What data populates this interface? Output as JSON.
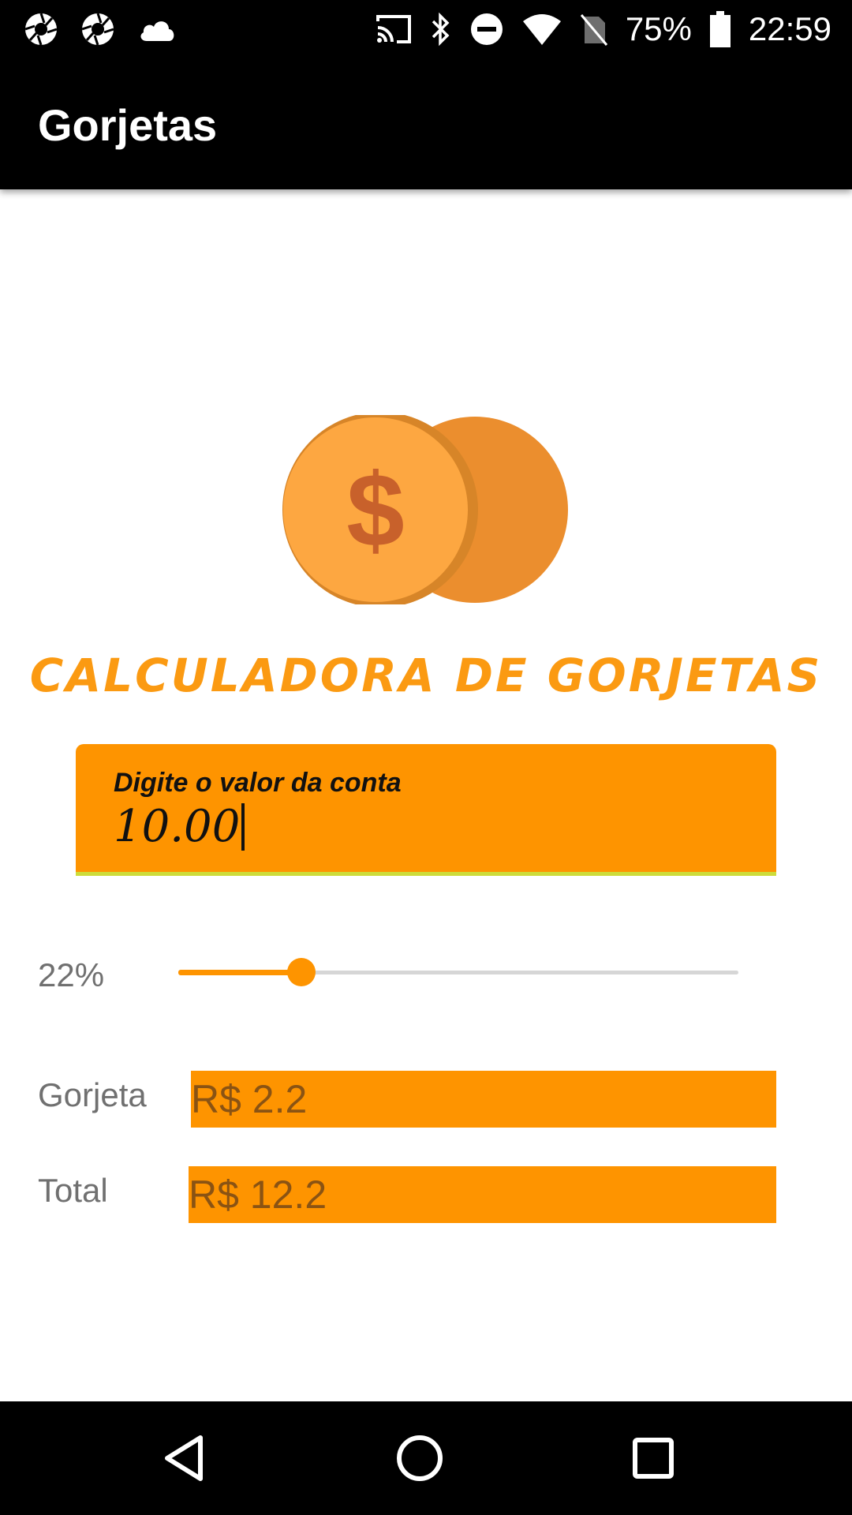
{
  "status_bar": {
    "battery_percent": "75%",
    "time": "22:59",
    "left_icons": [
      "camera-aperture-icon",
      "camera-aperture-icon",
      "cloud-icon"
    ],
    "right_icons": [
      "cast-icon",
      "bluetooth-icon",
      "do-not-disturb-icon",
      "wifi-icon",
      "no-sim-icon",
      "battery-icon"
    ]
  },
  "app_bar": {
    "title": "Gorjetas"
  },
  "logo": {
    "icon": "coins-dollar-icon",
    "symbol": "$"
  },
  "main": {
    "heading": "CALCULADORA DE GORJETAS",
    "bill_input": {
      "label": "Digite o valor da conta",
      "value": "10.00"
    },
    "tip_percent": {
      "label": "22%",
      "value": 22,
      "min": 0,
      "max": 100
    },
    "tip_row": {
      "label": "Gorjeta",
      "value": "R$ 2.2"
    },
    "total_row": {
      "label": "Total",
      "value": "R$ 12.2"
    }
  },
  "colors": {
    "accent": "#fe9400",
    "title_orange": "#fb9a12",
    "result_text": "#8a5313",
    "underline": "#cddc39"
  },
  "nav_bar": {
    "icons": [
      "back-icon",
      "home-icon",
      "recents-icon"
    ]
  }
}
